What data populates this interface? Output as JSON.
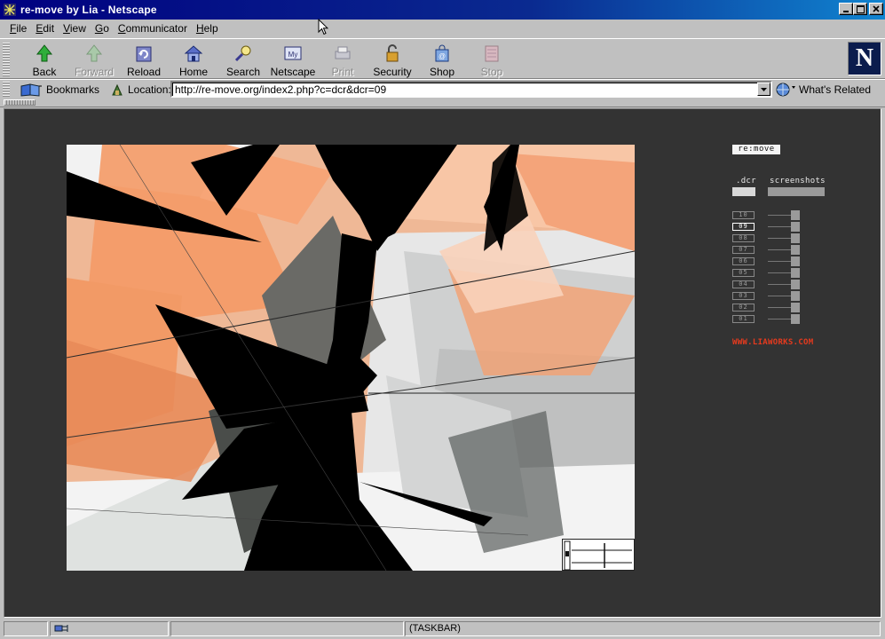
{
  "window": {
    "title": "re-move by Lia - Netscape",
    "controls": [
      "minimize",
      "maximize",
      "close"
    ]
  },
  "menu": [
    {
      "key": "F",
      "rest": "ile"
    },
    {
      "key": "E",
      "rest": "dit"
    },
    {
      "key": "V",
      "rest": "iew"
    },
    {
      "key": "G",
      "rest": "o"
    },
    {
      "key": "C",
      "rest": "ommunicator"
    },
    {
      "key": "H",
      "rest": "elp"
    }
  ],
  "toolbar": {
    "back": "Back",
    "forward": "Forward",
    "reload": "Reload",
    "home": "Home",
    "search": "Search",
    "netscape": "Netscape",
    "print": "Print",
    "security": "Security",
    "shop": "Shop",
    "stop": "Stop",
    "logo": "N",
    "netscape_icon_text": "My"
  },
  "location": {
    "bookmarks": "Bookmarks",
    "label": "Location:",
    "url": "http://re-move.org/index2.php?c=dcr&dcr=09",
    "related": "What's Related"
  },
  "page": {
    "logo": "re:move",
    "tab_dcr": ".dcr",
    "tab_screenshots": "screenshots",
    "versions": [
      "10",
      "09",
      "08",
      "07",
      "06",
      "05",
      "04",
      "03",
      "02",
      "01"
    ],
    "active_version": "09",
    "link": "WWW.LIAWORKS.COM"
  },
  "status": {
    "taskbar": "(TASKBAR)"
  },
  "colors": {
    "titlebar": "#000080",
    "content_bg": "#333333",
    "link": "#e63a1e",
    "art_orange": "#f0a070"
  }
}
